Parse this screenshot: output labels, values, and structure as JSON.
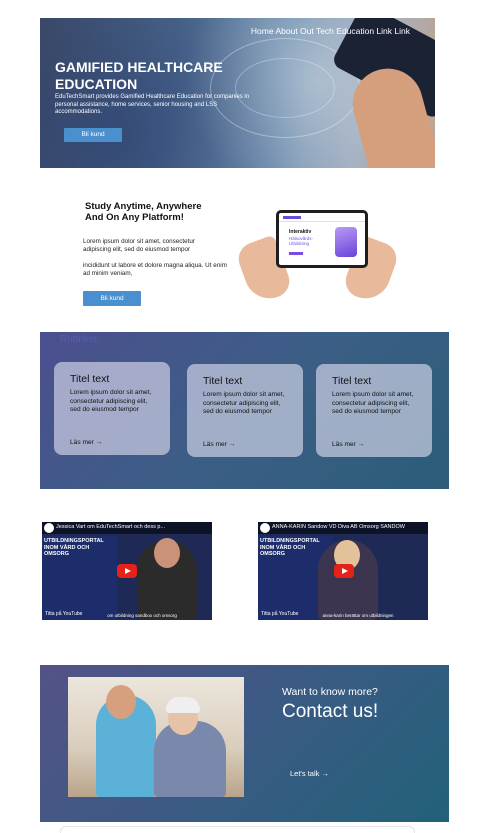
{
  "hero": {
    "nav": "Home About Out Tech Education Link Link",
    "title": "GAMIFIED HEALTHCARE EDUCATION",
    "description": "EduTechSmart provides Gamified Healthcare Education for companies in personal assistance, home services, senior housing and LSS accommodations.",
    "button": "Bli kund"
  },
  "study": {
    "title": "Study Anytime, Anywhere And On Any Platform!",
    "p1": "Lorem ipsum dolor sit amet, consectetur adipiscing elit, sed do eiusmod  tempor",
    "p2": "incididunt ut labore et dolore magna aliqua. Ut enim ad minim  veniam,",
    "button": "Bli kund",
    "tablet": {
      "heading": "Interaktiv",
      "subheading": "Hälsovårds-Utbildning"
    }
  },
  "cards_section": {
    "heading": "Rubriker",
    "cards": [
      {
        "title": "Titel text",
        "body": "Lorem ipsum dolor sit amet, consectetur adipiscing elit, sed do eiusmod tempor",
        "link": "Läs mer →"
      },
      {
        "title": "Titel text",
        "body": "Lorem ipsum dolor sit amet, consectetur adipiscing elit, sed do eiusmod tempor",
        "link": "Läs mer →"
      },
      {
        "title": "Titel text",
        "body": "Lorem ipsum dolor sit amet, consectetur adipiscing elit, sed do eiusmod tempor",
        "link": "Läs mer →"
      }
    ]
  },
  "videos": [
    {
      "title": "Jessica Vart om EduTechSmart och dess p...",
      "banner": "UTBILDNINGSPORTAL INOM VÅRD OCH OMSORG",
      "watch": "Titta på YouTube",
      "caption": "om utbildning sandbox och omsorg"
    },
    {
      "title": "ANNA-KARIN Sandow VD Diva AB Omsorg SANDOW",
      "banner": "UTBILDNINGSPORTAL INOM VÅRD OCH OMSORG",
      "watch": "Titta på YouTube",
      "caption": "anna-karin berättar om utbildningen"
    }
  ],
  "contact": {
    "small": "Want to know more?",
    "big": "Contact us!",
    "link": "Let's talk →"
  }
}
